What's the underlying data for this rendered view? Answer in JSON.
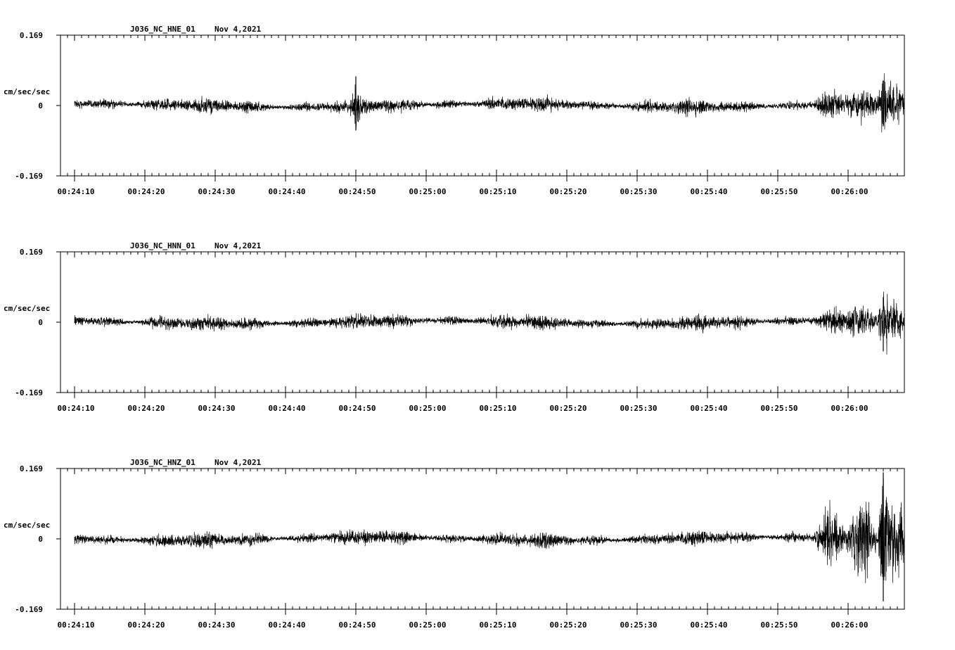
{
  "chart_data": [
    {
      "type": "line",
      "title": "J036_NC_HNE_01",
      "date": "Nov 4,2021",
      "ylabel": "cm/sec/sec",
      "ylim": [
        -0.169,
        0.169
      ],
      "yticks": [
        "0.169",
        "0",
        "-0.169"
      ],
      "xlim": [
        "00:24:08",
        "00:26:08"
      ],
      "xticks": [
        "00:24:10",
        "00:24:20",
        "00:24:30",
        "00:24:40",
        "00:24:50",
        "00:25:00",
        "00:25:10",
        "00:25:20",
        "00:25:30",
        "00:25:40",
        "00:25:50",
        "00:26:00"
      ],
      "series": [
        {
          "color": "#000000",
          "signal_start": "00:24:10",
          "spikes": [
            {
              "t": "00:24:50",
              "max": 0.07,
              "min": -0.06
            },
            {
              "t": "00:26:05",
              "max": 0.06,
              "min": -0.05
            }
          ]
        }
      ]
    },
    {
      "type": "line",
      "title": "J036_NC_HNN_01",
      "date": "Nov 4,2021",
      "ylabel": "cm/sec/sec",
      "ylim": [
        -0.169,
        0.169
      ],
      "yticks": [
        "0.169",
        "0",
        "-0.169"
      ],
      "xlim": [
        "00:24:08",
        "00:26:08"
      ],
      "xticks": [
        "00:24:10",
        "00:24:20",
        "00:24:30",
        "00:24:40",
        "00:24:50",
        "00:25:00",
        "00:25:10",
        "00:25:20",
        "00:25:30",
        "00:25:40",
        "00:25:50",
        "00:26:00"
      ],
      "series": [
        {
          "color": "#000000",
          "signal_start": "00:24:10",
          "spikes": [
            {
              "t": "00:26:05",
              "max": 0.06,
              "min": -0.07
            }
          ]
        }
      ]
    },
    {
      "type": "line",
      "title": "J036_NC_HNZ_01",
      "date": "Nov 4,2021",
      "ylabel": "cm/sec/sec",
      "ylim": [
        -0.169,
        0.169
      ],
      "yticks": [
        "0.169",
        "0",
        "-0.169"
      ],
      "xlim": [
        "00:24:08",
        "00:26:08"
      ],
      "xticks": [
        "00:24:10",
        "00:24:20",
        "00:24:30",
        "00:24:40",
        "00:24:50",
        "00:25:00",
        "00:25:10",
        "00:25:20",
        "00:25:30",
        "00:25:40",
        "00:25:50",
        "00:26:00"
      ],
      "series": [
        {
          "color": "#000000",
          "signal_start": "00:24:10",
          "spikes": [
            {
              "t": "00:26:05",
              "max": 0.16,
              "min": -0.15
            }
          ]
        }
      ]
    }
  ]
}
